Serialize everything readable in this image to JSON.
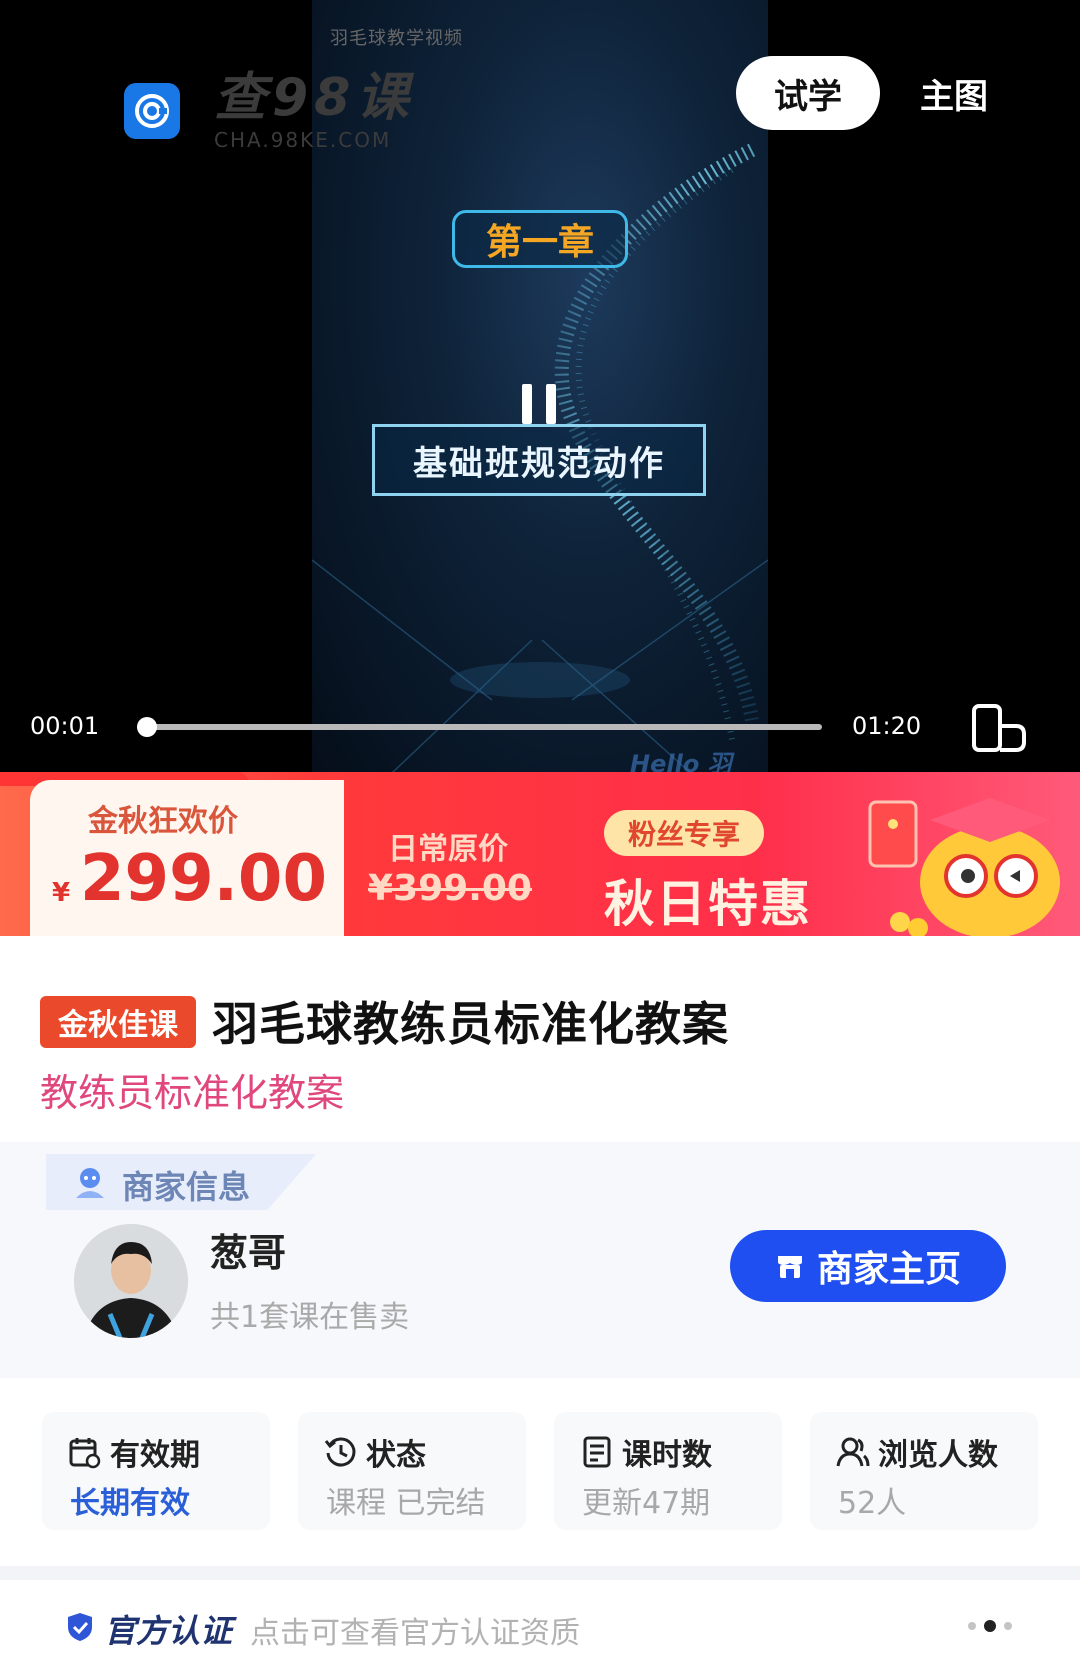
{
  "video": {
    "watermark_top": "羽毛球教学视频",
    "brand_name": "查98课",
    "brand_url": "CHA.98KE.COM",
    "tab_trial": "试学",
    "tab_main": "主图",
    "chapter_tag": "第一章",
    "chapter_title": "基础班规范动作",
    "video_logo": "Hello 羽",
    "time_current": "00:01",
    "time_total": "01:20",
    "progress": 0.0125
  },
  "promo": {
    "current_label": "金秋狂欢价",
    "currency": "¥",
    "current_price": "299.00",
    "original_label": "日常原价",
    "original_price": "¥399.00",
    "fans_pill": "粉丝专享",
    "deal_text": "秋日特惠"
  },
  "course": {
    "badge": "金秋佳课",
    "title": "羽毛球教练员标准化教案",
    "subtitle": "教练员标准化教案"
  },
  "merchant": {
    "section_label": "商家信息",
    "name": "葱哥",
    "sub": "共1套课在售卖",
    "button_label": "商家主页"
  },
  "stats": [
    {
      "label": "有效期",
      "value": "长期有效",
      "icon": "calendar-icon",
      "highlight": true
    },
    {
      "label": "状态",
      "value": "课程 已完结",
      "icon": "history-icon",
      "highlight": false
    },
    {
      "label": "课时数",
      "value": "更新47期",
      "icon": "document-icon",
      "highlight": false
    },
    {
      "label": "浏览人数",
      "value": "52人",
      "icon": "users-icon",
      "highlight": false
    }
  ],
  "cert": {
    "label": "官方认证",
    "desc": "点击可查看官方认证资质"
  },
  "colors": {
    "accent_blue": "#1f4ff0",
    "promo_red": "#ff3a3a",
    "price_red": "#e2332e",
    "subtitle_pink": "#e0477d"
  }
}
